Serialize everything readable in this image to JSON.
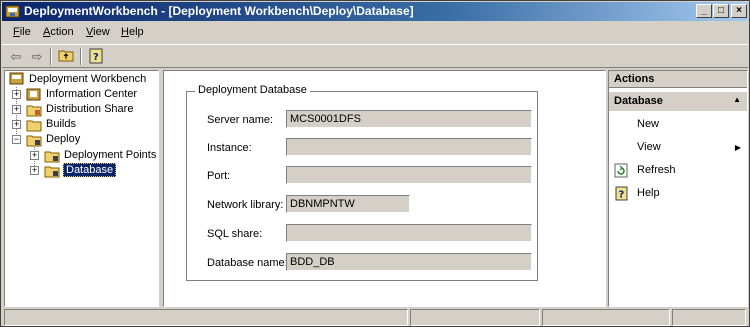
{
  "window": {
    "title": "DeploymentWorkbench - [Deployment Workbench\\Deploy\\Database]",
    "minimize_label": "_",
    "maximize_label": "□",
    "close_label": "×"
  },
  "menu": {
    "items": [
      {
        "mnemonic": "F",
        "rest": "ile"
      },
      {
        "mnemonic": "A",
        "rest": "ction"
      },
      {
        "mnemonic": "V",
        "rest": "iew"
      },
      {
        "mnemonic": "H",
        "rest": "elp"
      }
    ]
  },
  "toolbar": {
    "back_glyph": "⇦",
    "forward_glyph": "⇨",
    "up_icon": "up-folder-icon",
    "help_icon": "help-book-icon"
  },
  "tree": {
    "root": "Deployment Workbench",
    "items": [
      {
        "label": "Information Center"
      },
      {
        "label": "Distribution Share"
      },
      {
        "label": "Builds"
      },
      {
        "label": "Deploy"
      },
      {
        "label": "Deployment Points"
      },
      {
        "label": "Database"
      }
    ]
  },
  "form": {
    "group_title": "Deployment Database",
    "fields": [
      {
        "label": "Server name:",
        "value": ""
      },
      {
        "label": "Instance:",
        "value": ""
      },
      {
        "label": "Port:",
        "value": ""
      },
      {
        "label": "Network library:",
        "value": "DBNMPNTW"
      },
      {
        "label": "SQL share:",
        "value": ""
      },
      {
        "label": "Database name:",
        "value": "BDD_DB"
      }
    ],
    "server_value": "MCS0001DFS"
  },
  "actions": {
    "header": "Actions",
    "section": "Database",
    "items": [
      {
        "label": "New"
      },
      {
        "label": "View"
      },
      {
        "label": "Refresh"
      },
      {
        "label": "Help"
      }
    ]
  },
  "colors": {
    "title_active": "#0a246a",
    "face": "#d4d0c8",
    "selection": "#0a246a"
  }
}
